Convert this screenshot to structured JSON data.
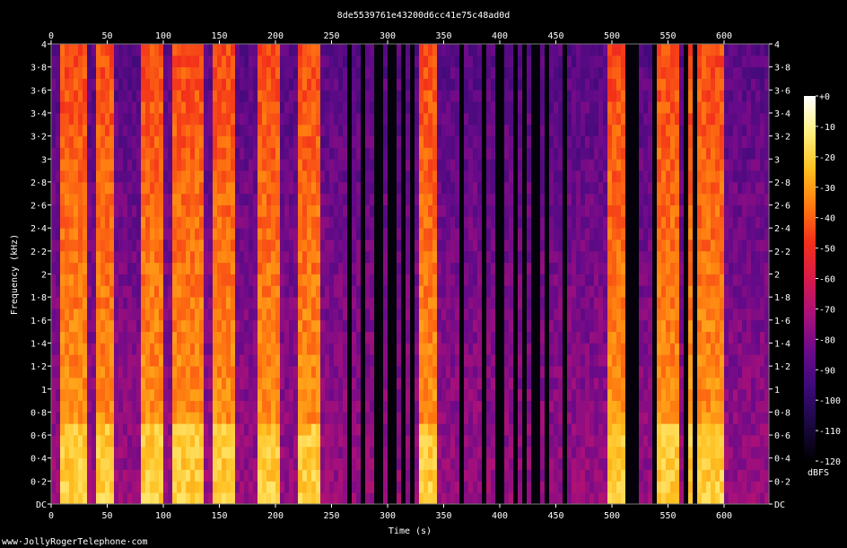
{
  "chart_data": {
    "type": "heatmap",
    "title": "8de5539761e43200d6cc41e75c48ad0d",
    "xlabel": "Time (s)",
    "ylabel": "Frequency (kHz)",
    "xlim": [
      0,
      640
    ],
    "ylim": [
      0,
      4
    ],
    "x_ticks": [
      0,
      50,
      100,
      150,
      200,
      250,
      300,
      350,
      400,
      450,
      500,
      550,
      600
    ],
    "x_tick_labels": [
      "0",
      "50",
      "100",
      "150",
      "200",
      "250",
      "300",
      "350",
      "400",
      "450",
      "500",
      "550",
      "600"
    ],
    "y_ticks": [
      0,
      0.2,
      0.4,
      0.6,
      0.8,
      1,
      1.2,
      1.4,
      1.6,
      1.8,
      2,
      2.2,
      2.4,
      2.6,
      2.8,
      3,
      3.2,
      3.4,
      3.6,
      3.8,
      4
    ],
    "y_tick_labels": [
      "DC",
      "0·2",
      "0·4",
      "0·6",
      "0·8",
      "1",
      "1·2",
      "1·4",
      "1·6",
      "1·8",
      "2",
      "2·2",
      "2·4",
      "2·6",
      "2·8",
      "3",
      "3·2",
      "3·4",
      "3·6",
      "3·8",
      "4"
    ],
    "colorbar": {
      "label": "dBFS",
      "range": [
        -120,
        0
      ],
      "ticks": [
        0,
        -10,
        -20,
        -30,
        -40,
        -50,
        -60,
        -70,
        -80,
        -90,
        -100,
        -110,
        -120
      ],
      "tick_labels": [
        "+0",
        "-10",
        "-20",
        "-30",
        "-40",
        "-50",
        "-60",
        "-70",
        "-80",
        "-90",
        "-100",
        "-110",
        "-120"
      ],
      "colormap": [
        "#000000",
        "#1a0840",
        "#3a0a78",
        "#6a0a8a",
        "#a8107a",
        "#d81a4a",
        "#f3301a",
        "#ff7a10",
        "#ffc020",
        "#fff080",
        "#ffffff"
      ]
    },
    "silent_intervals_s": [
      [
        264,
        267
      ],
      [
        275,
        280
      ],
      [
        290,
        296
      ],
      [
        302,
        306
      ],
      [
        312,
        316
      ],
      [
        320,
        324
      ],
      [
        365,
        369
      ],
      [
        383,
        387
      ],
      [
        398,
        402
      ],
      [
        412,
        416
      ],
      [
        421,
        425
      ],
      [
        430,
        434
      ],
      [
        440,
        444
      ],
      [
        455,
        459
      ],
      [
        512,
        516
      ],
      [
        518,
        522
      ],
      [
        537,
        540
      ],
      [
        563,
        567
      ],
      [
        572,
        575
      ]
    ],
    "loud_regions_s": [
      [
        10,
        30
      ],
      [
        40,
        55
      ],
      [
        80,
        100
      ],
      [
        110,
        135
      ],
      [
        145,
        165
      ],
      [
        185,
        205
      ],
      [
        220,
        240
      ],
      [
        330,
        345
      ],
      [
        495,
        512
      ],
      [
        540,
        560
      ],
      [
        570,
        600
      ]
    ],
    "background_level_dbfs": -75,
    "loud_level_dbfs": -30
  },
  "footer": {
    "credit": "www·JollyRogerTelephone·com"
  }
}
